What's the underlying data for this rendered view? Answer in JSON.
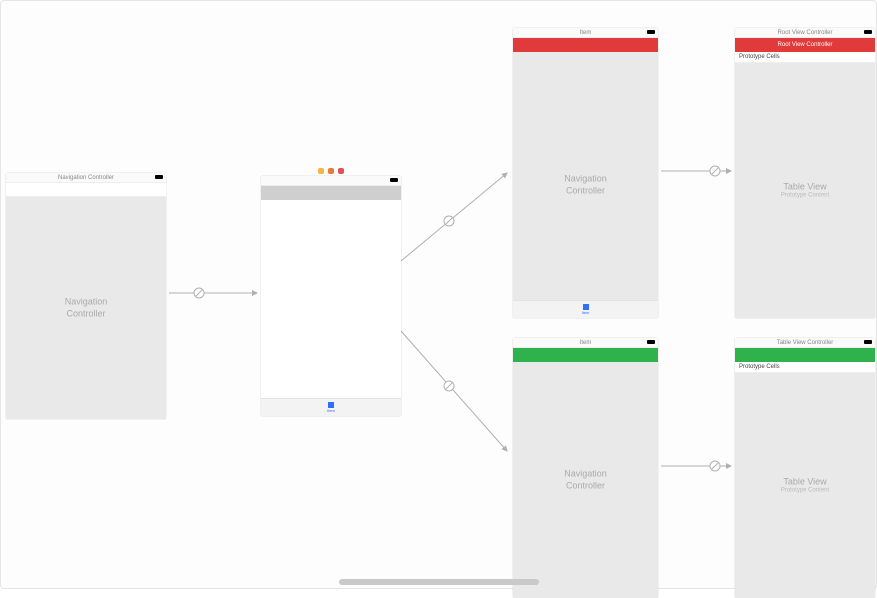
{
  "scenes": {
    "leftNav": {
      "title": "Navigation Controller",
      "bodyLabel": "Navigation Controller"
    },
    "center": {
      "title": "",
      "tabItemLabel": "Item"
    },
    "topNav": {
      "title": "Item",
      "bodyLabel": "Navigation Controller"
    },
    "topTable": {
      "title": "Root View Controller",
      "navbarLabel": "Root View Controller",
      "protoCells": "Prototype Cells",
      "tableLabel": "Table View",
      "tableSub": "Prototype Content"
    },
    "botNav": {
      "title": "Item",
      "bodyLabel": "Navigation Controller"
    },
    "botTable": {
      "title": "Table View Controller",
      "protoCells": "Prototype Cells",
      "tableLabel": "Table View",
      "tableSub": "Prototype Content"
    }
  }
}
